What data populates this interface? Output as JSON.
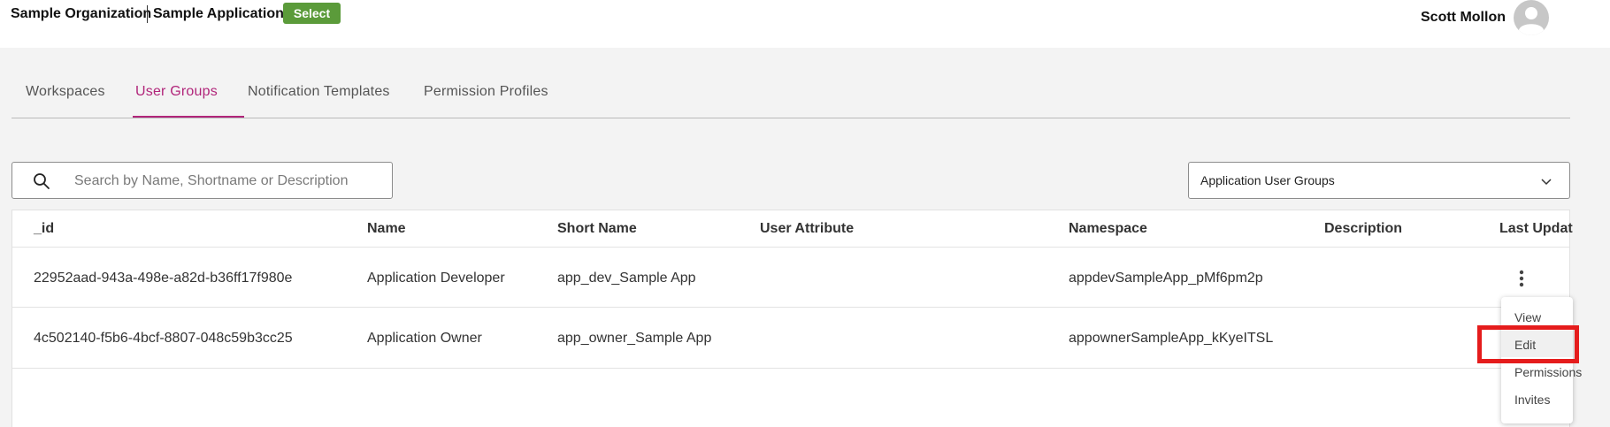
{
  "header": {
    "organization": "Sample Organization",
    "application": "Sample Application",
    "select_label": "Select",
    "user_name": "Scott Mollon"
  },
  "tabs": [
    {
      "label": "Workspaces",
      "active": false
    },
    {
      "label": "User Groups",
      "active": true
    },
    {
      "label": "Notification Templates",
      "active": false
    },
    {
      "label": "Permission Profiles",
      "active": false
    }
  ],
  "search": {
    "placeholder": "Search by Name, Shortname or Description",
    "value": ""
  },
  "filter": {
    "selected": "Application User Groups"
  },
  "table": {
    "columns": [
      "_id",
      "Name",
      "Short Name",
      "User Attribute",
      "Namespace",
      "Description",
      "Last Updat"
    ],
    "rows": [
      {
        "id": "22952aad-943a-498e-a82d-b36ff17f980e",
        "name": "Application Developer",
        "short_name": "app_dev_Sample App",
        "user_attribute": "",
        "namespace": "appdevSampleApp_pMf6pm2p",
        "description": ""
      },
      {
        "id": "4c502140-f5b6-4bcf-8807-048c59b3cc25",
        "name": "Application Owner",
        "short_name": "app_owner_Sample App",
        "user_attribute": "",
        "namespace": "appownerSampleApp_kKyeITSL",
        "description": ""
      }
    ]
  },
  "context_menu": {
    "items": [
      "View",
      "Edit",
      "Permissions",
      "Invites"
    ]
  },
  "colors": {
    "accent": "#b1257a",
    "select_button": "#5b9b3a",
    "highlight": "#e51c1c"
  }
}
